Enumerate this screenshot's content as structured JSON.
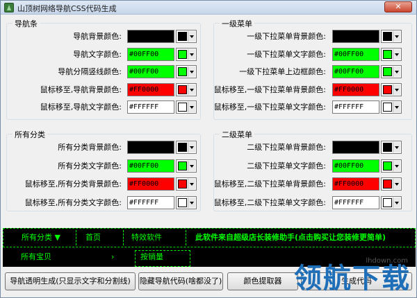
{
  "window": {
    "title": "山顶树网络导航CSS代码生成",
    "close_label": "✕"
  },
  "colors": {
    "black": "#000000",
    "green": "#00FF00",
    "red": "#FF0000",
    "white": "#FFFFFF"
  },
  "groups": {
    "nav": {
      "title": "导航条",
      "rows": [
        {
          "label": "导航背景颜色:",
          "value": "",
          "swatch": "#000000"
        },
        {
          "label": "导航文字颜色:",
          "value": "#00FF00",
          "swatch": "#00FF00"
        },
        {
          "label": "导航分隔竖线颜色:",
          "value": "#00FF00",
          "swatch": "#00FF00"
        },
        {
          "label": "鼠标移至,导航背景颜色:",
          "value": "#FF0000",
          "swatch": "#FF0000"
        },
        {
          "label": "鼠标移至,导航文字颜色:",
          "value": "#FFFFFF",
          "swatch": "#FFFFFF"
        }
      ]
    },
    "menu1": {
      "title": "一级菜单",
      "rows": [
        {
          "label": "一级下拉菜单背景颜色:",
          "value": "",
          "swatch": "#000000"
        },
        {
          "label": "一级下拉菜单文字颜色:",
          "value": "#00FF00",
          "swatch": "#00FF00"
        },
        {
          "label": "一级下拉菜单上边框颜色:",
          "value": "#00FF00",
          "swatch": "#00FF00"
        },
        {
          "label": "鼠标移至,一级下拉菜单背景颜色:",
          "value": "#FF0000",
          "swatch": "#FF0000"
        },
        {
          "label": "鼠标移至,一级下拉菜单文字颜色:",
          "value": "#FFFFFF",
          "swatch": "#FFFFFF"
        }
      ]
    },
    "all": {
      "title": "所有分类",
      "rows": [
        {
          "label": "所有分类背景颜色:",
          "value": "",
          "swatch": "#000000"
        },
        {
          "label": "所有分类文字颜色:",
          "value": "#00FF00",
          "swatch": "#00FF00"
        },
        {
          "label": "鼠标移至,所有分类背景颜色:",
          "value": "#FF0000",
          "swatch": "#FF0000"
        },
        {
          "label": "鼠标移至,所有分类文字颜色:",
          "value": "#FFFFFF",
          "swatch": "#FFFFFF"
        }
      ]
    },
    "menu2": {
      "title": "二级菜单",
      "rows": [
        {
          "label": "二级下拉菜单背景颜色:",
          "value": "",
          "swatch": "#000000"
        },
        {
          "label": "二级下拉菜单文字颜色:",
          "value": "#00FF00",
          "swatch": "#00FF00"
        },
        {
          "label": "鼠标移至,二级下拉菜单背景颜色:",
          "value": "#FF0000",
          "swatch": "#FF0000"
        },
        {
          "label": "鼠标移至,二级下拉菜单文字颜色:",
          "value": "#FFFFFF",
          "swatch": "#FFFFFF"
        }
      ]
    }
  },
  "preview": {
    "nav_items": [
      "所有分类 ▼",
      "首页",
      "特效软件",
      "此软件来自超级店长装修助手(点击购买让您装修更简单)"
    ],
    "sub_items": [
      "所有宝贝",
      "›",
      "按销量"
    ]
  },
  "buttons": {
    "gen_transparent": "导航透明生成(只显示文字和分割线)",
    "hide_code": "隐藏导航代码(啥都没了)",
    "color_picker": "颜色提取器",
    "gen_code": "生成代码"
  },
  "watermark": {
    "text": "领航下载",
    "url": "lhdown.com"
  }
}
